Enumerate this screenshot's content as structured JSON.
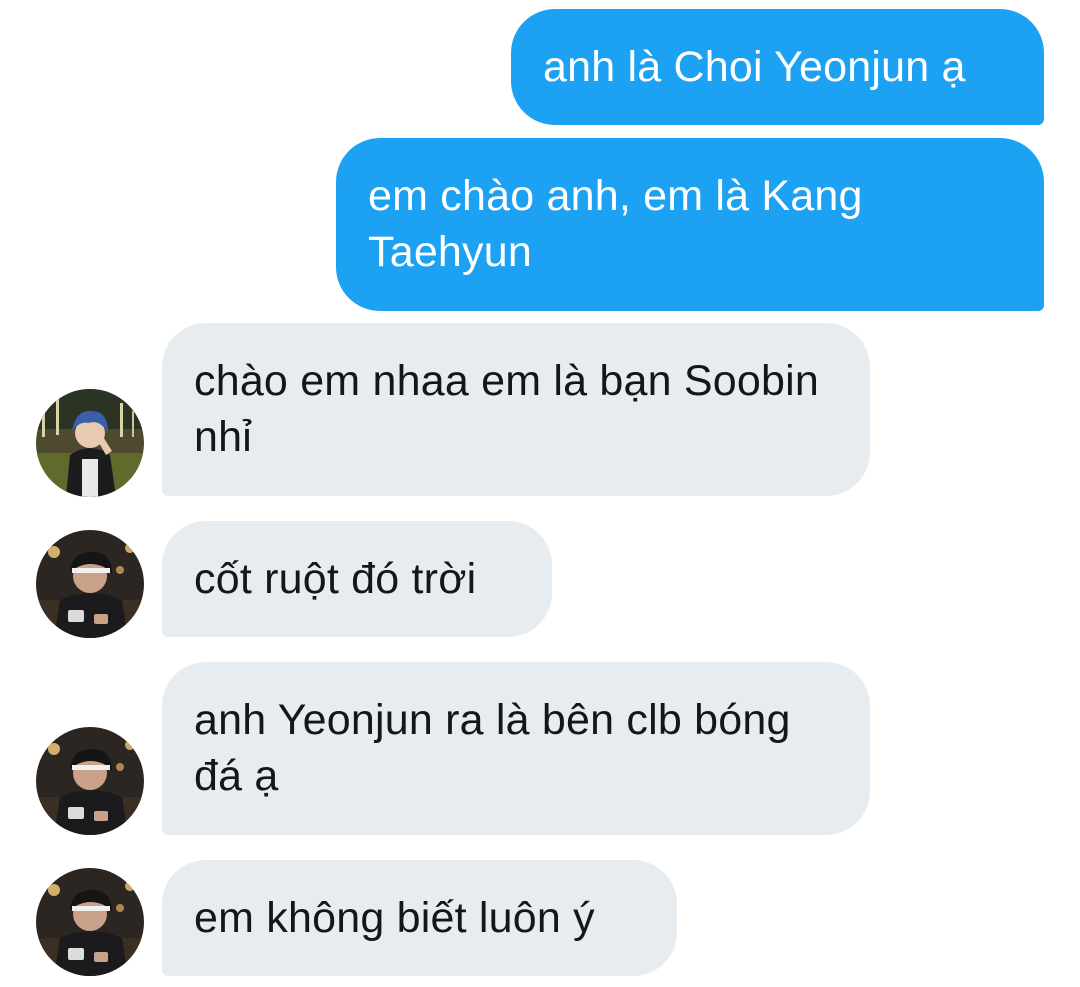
{
  "conversation": {
    "messages": [
      {
        "direction": "outgoing",
        "text": "anh là Choi Yeonjun ạ"
      },
      {
        "direction": "outgoing",
        "text": "em chào anh, em là Kang Taehyun"
      },
      {
        "direction": "incoming",
        "text": "chào em nhaa em là bạn Soobin nhỉ",
        "avatar": "avatar-blue-hair-icon"
      },
      {
        "direction": "incoming",
        "text": "cốt ruột đó trời",
        "avatar": "avatar-cap-phone-icon"
      },
      {
        "direction": "incoming",
        "text": "anh Yeonjun ra là bên clb bóng đá ạ",
        "avatar": "avatar-cap-phone-icon"
      },
      {
        "direction": "incoming",
        "text": "em không biết luôn ý",
        "avatar": "avatar-cap-phone-icon"
      }
    ]
  },
  "colors": {
    "outgoing_bubble": "#1da1f2",
    "incoming_bubble": "#e6ecf0",
    "outgoing_text": "#ffffff",
    "incoming_text": "#14171a",
    "background": "#ffffff"
  }
}
